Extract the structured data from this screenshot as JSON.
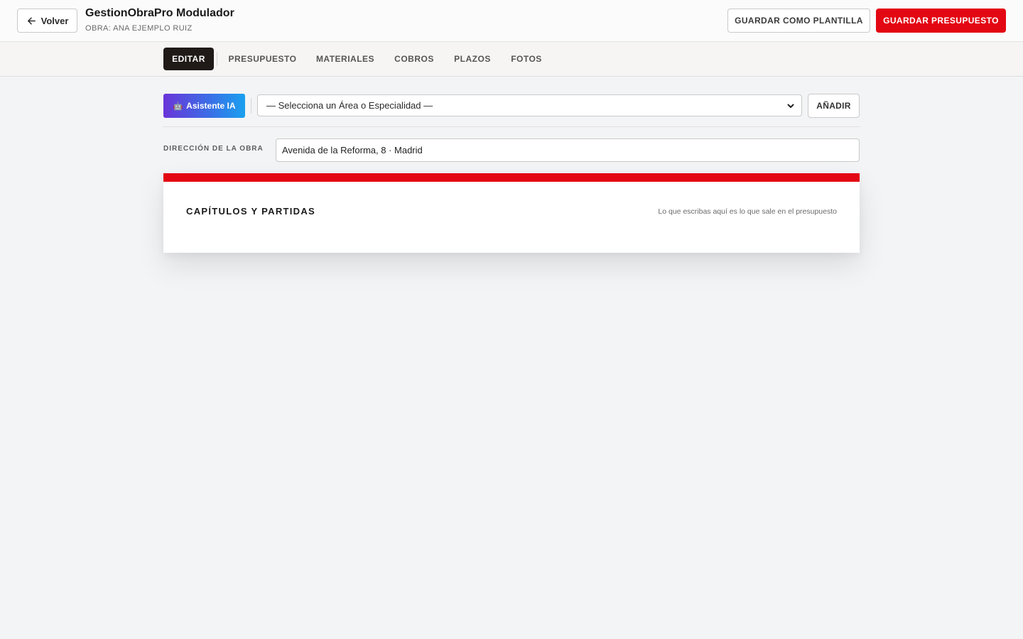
{
  "header": {
    "back_label": "Volver",
    "title": "GestionObraPro Modulador",
    "subtitle": "OBRA: ANA EJEMPLO RUIZ",
    "save_template_label": "GUARDAR COMO PLANTILLA",
    "save_budget_label": "GUARDAR PRESUPUESTO",
    "accent_color": "#e30613"
  },
  "tabs": [
    {
      "label": "EDITAR",
      "active": true
    },
    {
      "label": "PRESUPUESTO",
      "active": false
    },
    {
      "label": "MATERIALES",
      "active": false
    },
    {
      "label": "COBROS",
      "active": false
    },
    {
      "label": "PLAZOS",
      "active": false
    },
    {
      "label": "FOTOS",
      "active": false
    }
  ],
  "toolbar": {
    "ai_icon": "robot-icon",
    "ai_label": "Asistente IA",
    "area_select_value": "— Selecciona un Área o Especialidad —",
    "add_label": "AÑADIR"
  },
  "address": {
    "label": "DIRECCIÓN DE LA OBRA",
    "value": "Avenida de la Reforma, 8 · Madrid"
  },
  "chapters": {
    "title": "CAPÍTULOS Y PARTIDAS",
    "hint": "Lo que escribas aquí es lo que sale en el presupuesto"
  }
}
